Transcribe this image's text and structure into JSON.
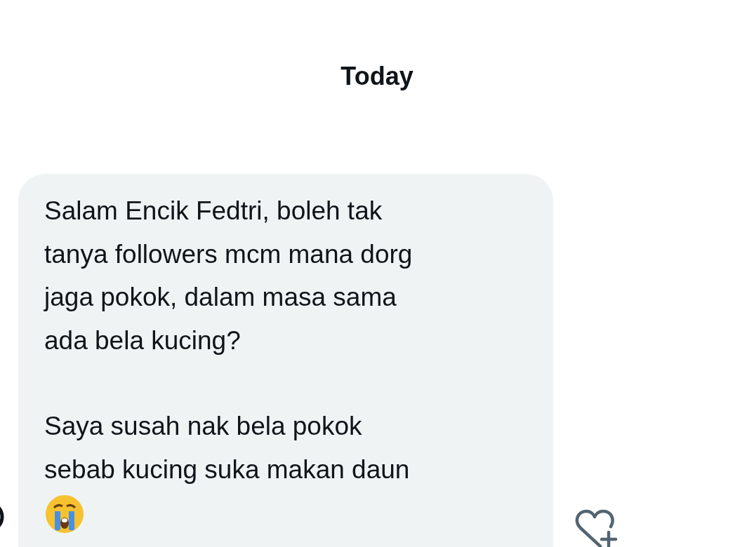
{
  "date_divider": "Today",
  "message": {
    "paragraphs": [
      "Salam Encik Fedtri, boleh tak\ntanya followers mcm mana dorg\njaga pokok, dalam masa sama\nada bela kucing?",
      "Saya susah nak bela pokok\nsebab kucing suka makan daun"
    ]
  }
}
